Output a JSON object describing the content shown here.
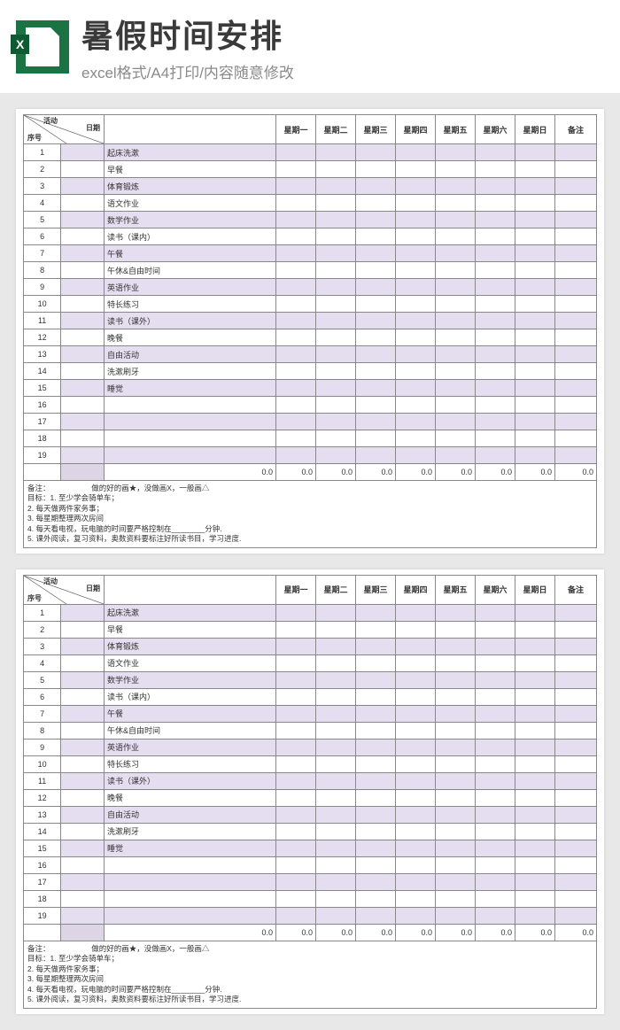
{
  "hero": {
    "icon_text": "X",
    "title": "暑假时间安排",
    "subtitle": "excel格式/A4打印/内容随意修改"
  },
  "header": {
    "diag_activity": "活动",
    "diag_date": "日期",
    "diag_seq": "序号",
    "days": [
      "星期一",
      "星期二",
      "星期三",
      "星期四",
      "星期五",
      "星期六",
      "星期日"
    ],
    "remark": "备注"
  },
  "chart_data": {
    "type": "table",
    "title": "暑假时间安排",
    "columns": [
      "序号",
      "活动",
      "星期一",
      "星期二",
      "星期三",
      "星期四",
      "星期五",
      "星期六",
      "星期日",
      "备注"
    ],
    "rows": [
      {
        "seq": "1",
        "activity": "起床洗漱"
      },
      {
        "seq": "2",
        "activity": "早餐"
      },
      {
        "seq": "3",
        "activity": "体育锻炼"
      },
      {
        "seq": "4",
        "activity": "语文作业"
      },
      {
        "seq": "5",
        "activity": "数学作业"
      },
      {
        "seq": "6",
        "activity": "读书（课内）"
      },
      {
        "seq": "7",
        "activity": "午餐"
      },
      {
        "seq": "8",
        "activity": "午休&自由时间"
      },
      {
        "seq": "9",
        "activity": "英语作业"
      },
      {
        "seq": "10",
        "activity": "特长练习"
      },
      {
        "seq": "11",
        "activity": "读书（课外）"
      },
      {
        "seq": "12",
        "activity": "晚餐"
      },
      {
        "seq": "13",
        "activity": "自由活动"
      },
      {
        "seq": "14",
        "activity": "洗漱刷牙"
      },
      {
        "seq": "15",
        "activity": "睡觉"
      },
      {
        "seq": "16",
        "activity": ""
      },
      {
        "seq": "17",
        "activity": ""
      },
      {
        "seq": "18",
        "activity": ""
      },
      {
        "seq": "19",
        "activity": ""
      }
    ],
    "totals_row": [
      "",
      "",
      "0.0",
      "0.0",
      "0.0",
      "0.0",
      "0.0",
      "0.0",
      "0.0",
      "0.0"
    ],
    "notes": [
      "备注：　　　　　　做的好的画★，没做画X，一般画△",
      "目标：1. 至少学会骑单车；",
      "2. 每天做两件家务事；",
      "3. 每星期整理两次房间",
      "4. 每天看电视，玩电脑的时间要严格控制在________分钟.",
      "5. 课外阅读，复习资料，奥数资料要标注好所读书目，学习进度."
    ]
  }
}
